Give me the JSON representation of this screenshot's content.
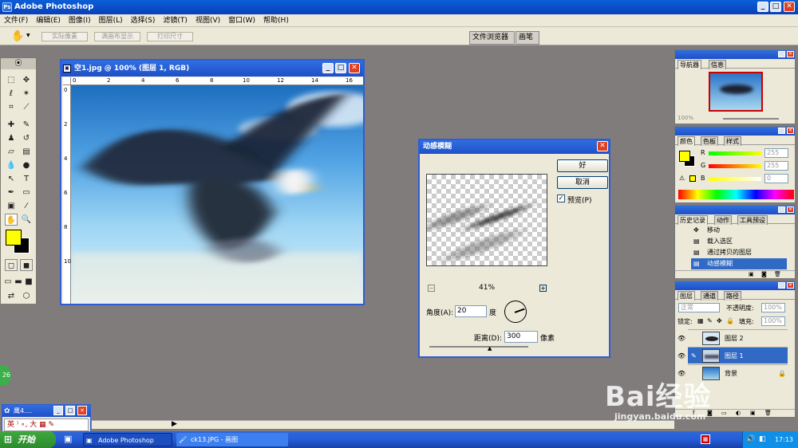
{
  "app": {
    "title": "Adobe Photoshop",
    "icon_label": "Ps"
  },
  "menu": [
    "文件(F)",
    "编辑(E)",
    "图像(I)",
    "图层(L)",
    "选择(S)",
    "滤镜(T)",
    "视图(V)",
    "窗口(W)",
    "帮助(H)"
  ],
  "options_bar": {
    "tool_icon": "hand-icon",
    "buttons": [
      "实际像素",
      "满画布显示",
      "打印尺寸"
    ],
    "palette_well": [
      "文件浏览器",
      "画笔"
    ]
  },
  "image_window": {
    "title": "空1.jpg @ 100% (图层 1, RGB)",
    "ruler_top": [
      "0",
      "2",
      "4",
      "6",
      "8",
      "10",
      "12",
      "14",
      "16"
    ],
    "ruler_left": [
      "0",
      "2",
      "4",
      "6",
      "8",
      "10"
    ]
  },
  "dialog": {
    "title": "动感模糊",
    "ok": "好",
    "cancel": "取消",
    "preview_label": "预览(P)",
    "preview_checked": true,
    "zoom": "41%",
    "zoom_out": "−",
    "zoom_in": "+",
    "angle_label": "角度(A):",
    "angle_value": "20",
    "angle_unit": "度",
    "distance_label": "距离(D):",
    "distance_value": "300",
    "distance_unit": "像素"
  },
  "navigator": {
    "tabs": [
      "导航器",
      "信息"
    ],
    "zoom": "100%"
  },
  "color": {
    "tabs": [
      "颜色",
      "色板",
      "样式"
    ],
    "channels": [
      {
        "label": "R",
        "value": "255"
      },
      {
        "label": "G",
        "value": "255"
      },
      {
        "label": "B",
        "value": "0"
      }
    ],
    "foreground": "#ffff00",
    "background": "#000000"
  },
  "history": {
    "tabs": [
      "历史记录",
      "动作",
      "工具预设"
    ],
    "items": [
      "移动",
      "载入选区",
      "通过拷贝的图层",
      "动感模糊"
    ],
    "selected_index": 3
  },
  "layers": {
    "tabs": [
      "图层",
      "通道",
      "路径"
    ],
    "blend_mode": "正常",
    "opacity_label": "不透明度:",
    "opacity": "100%",
    "lock_label": "锁定:",
    "fill_label": "填充:",
    "fill": "100%",
    "items": [
      {
        "name": "图层 2",
        "selected": false
      },
      {
        "name": "图层 1",
        "selected": true
      },
      {
        "name": "背景",
        "selected": false
      }
    ]
  },
  "ime": {
    "title": "鹰4....",
    "toolbar": "英 ⁾ ∘, 大 ▦ ✎"
  },
  "desktop_badge": "26",
  "taskbar": {
    "start": "开始",
    "tasks": [
      "Adobe Photoshop",
      "ck13.JPG - 画图"
    ],
    "time": "17:13"
  },
  "watermark": {
    "logo": "Bai经验",
    "url": "jingyan.baidu.com"
  }
}
